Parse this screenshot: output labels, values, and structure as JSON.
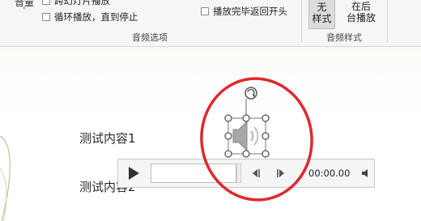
{
  "ribbon": {
    "volume_label": "音量",
    "volume_chevron": "˅",
    "cut_off_option": "跨幻灯片播放",
    "loop_option": "循环播放，直到停止",
    "rewind_option": "播放完毕返回开头",
    "audio_options_group": "音频选项",
    "style_none_label_1": "无",
    "style_none_label_2": "样式",
    "style_bg_label_1": "在后",
    "style_bg_label_2": "台播放",
    "audio_styles_group": "音频样式"
  },
  "slide": {
    "text1": "测试内容1",
    "text2": "测试内容2"
  },
  "player": {
    "time": "00:00.00"
  },
  "colors": {
    "annotation_red": "#e0282e",
    "ribbon_bg": "#f6f6f6",
    "selected_style_bg": "#dcdcdc"
  }
}
